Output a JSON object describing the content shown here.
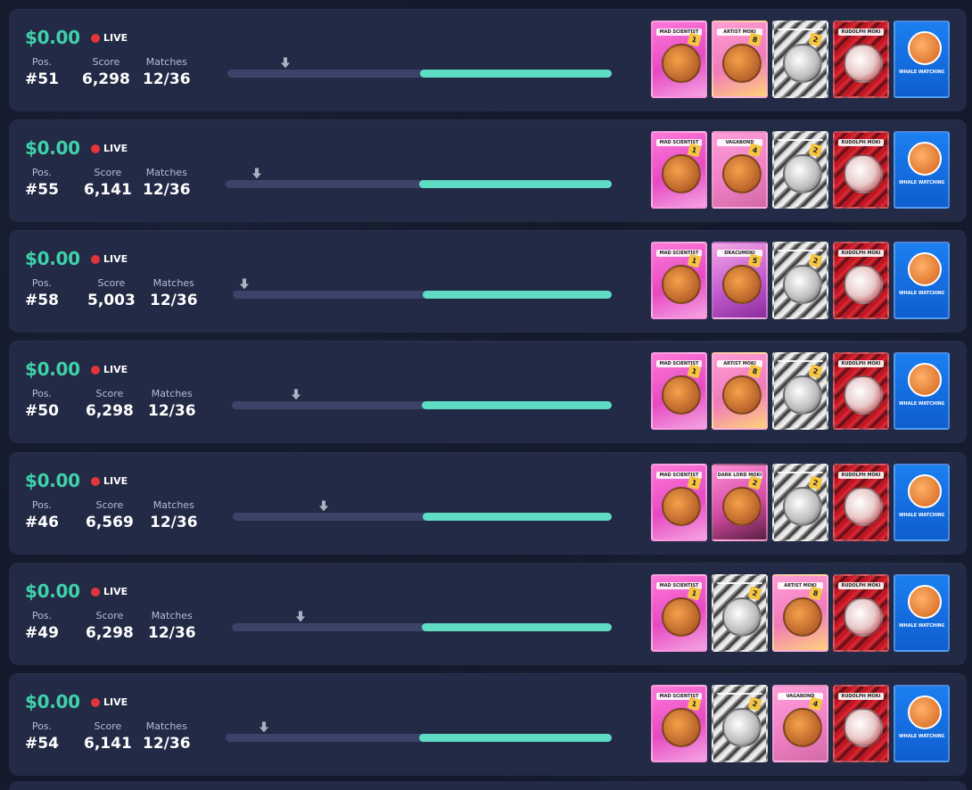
{
  "labels": {
    "live": "LIVE",
    "pos": "Pos.",
    "score": "Score",
    "matches": "Matches"
  },
  "colors": {
    "prize": "#3fd1a9",
    "live_dot": "#e2353b",
    "progress_fill": "#5fdcc4",
    "progress_track": "#3b4468",
    "row_bg": "#232a45"
  },
  "rows": [
    {
      "prize": "$0.00",
      "pos": "#51",
      "score": "6,298",
      "matches": "12/36",
      "progress": 0.5,
      "marker": 0.15,
      "cards": [
        {
          "type": "mad",
          "title": "MAD SCIENTIST",
          "badge": "1"
        },
        {
          "type": "art",
          "title": "ARTIST MOKI",
          "badge": "8"
        },
        {
          "type": "gray",
          "title": "",
          "badge": "2"
        },
        {
          "type": "red",
          "title": "RUDOLPH MOKI",
          "badge": ""
        },
        {
          "type": "blue",
          "title": "WHALE WATCHING",
          "badge": ""
        }
      ]
    },
    {
      "prize": "$0.00",
      "pos": "#55",
      "score": "6,141",
      "matches": "12/36",
      "progress": 0.5,
      "marker": 0.08,
      "cards": [
        {
          "type": "mad",
          "title": "MAD SCIENTIST",
          "badge": "1"
        },
        {
          "type": "vag",
          "title": "VAGABOND",
          "badge": "4"
        },
        {
          "type": "gray",
          "title": "",
          "badge": "2"
        },
        {
          "type": "red",
          "title": "RUDOLPH MOKI",
          "badge": ""
        },
        {
          "type": "blue",
          "title": "WHALE WATCHING",
          "badge": ""
        }
      ]
    },
    {
      "prize": "$0.00",
      "pos": "#58",
      "score": "5,003",
      "matches": "12/36",
      "progress": 0.5,
      "marker": 0.03,
      "cards": [
        {
          "type": "mad",
          "title": "MAD SCIENTIST",
          "badge": "1"
        },
        {
          "type": "drac",
          "title": "DRACUMOKI",
          "badge": "5"
        },
        {
          "type": "gray",
          "title": "",
          "badge": "2"
        },
        {
          "type": "red",
          "title": "RUDOLPH MOKI",
          "badge": ""
        },
        {
          "type": "blue",
          "title": "WHALE WATCHING",
          "badge": ""
        }
      ]
    },
    {
      "prize": "$0.00",
      "pos": "#50",
      "score": "6,298",
      "matches": "12/36",
      "progress": 0.5,
      "marker": 0.17,
      "cards": [
        {
          "type": "mad",
          "title": "MAD SCIENTIST",
          "badge": "1"
        },
        {
          "type": "art",
          "title": "ARTIST MOKI",
          "badge": "8"
        },
        {
          "type": "gray",
          "title": "",
          "badge": "2"
        },
        {
          "type": "red",
          "title": "RUDOLPH MOKI",
          "badge": ""
        },
        {
          "type": "blue",
          "title": "WHALE WATCHING",
          "badge": ""
        }
      ]
    },
    {
      "prize": "$0.00",
      "pos": "#46",
      "score": "6,569",
      "matches": "12/36",
      "progress": 0.5,
      "marker": 0.24,
      "cards": [
        {
          "type": "mad",
          "title": "MAD SCIENTIST",
          "badge": "1"
        },
        {
          "type": "dark",
          "title": "DARK LORD MOKI",
          "badge": "2"
        },
        {
          "type": "gray",
          "title": "",
          "badge": "2"
        },
        {
          "type": "red",
          "title": "RUDOLPH MOKI",
          "badge": ""
        },
        {
          "type": "blue",
          "title": "WHALE WATCHING",
          "badge": ""
        }
      ]
    },
    {
      "prize": "$0.00",
      "pos": "#49",
      "score": "6,298",
      "matches": "12/36",
      "progress": 0.5,
      "marker": 0.18,
      "cards": [
        {
          "type": "mad",
          "title": "MAD SCIENTIST",
          "badge": "1"
        },
        {
          "type": "gray",
          "title": "",
          "badge": "2"
        },
        {
          "type": "art",
          "title": "ARTIST MOKI",
          "badge": "8"
        },
        {
          "type": "red",
          "title": "RUDOLPH MOKI",
          "badge": ""
        },
        {
          "type": "blue",
          "title": "WHALE WATCHING",
          "badge": ""
        }
      ]
    },
    {
      "prize": "$0.00",
      "pos": "#54",
      "score": "6,141",
      "matches": "12/36",
      "progress": 0.5,
      "marker": 0.1,
      "cards": [
        {
          "type": "mad",
          "title": "MAD SCIENTIST",
          "badge": "1"
        },
        {
          "type": "gray",
          "title": "",
          "badge": "2"
        },
        {
          "type": "vag",
          "title": "VAGABOND",
          "badge": "4"
        },
        {
          "type": "red",
          "title": "RUDOLPH MOKI",
          "badge": ""
        },
        {
          "type": "blue",
          "title": "WHALE WATCHING",
          "badge": ""
        }
      ]
    }
  ]
}
